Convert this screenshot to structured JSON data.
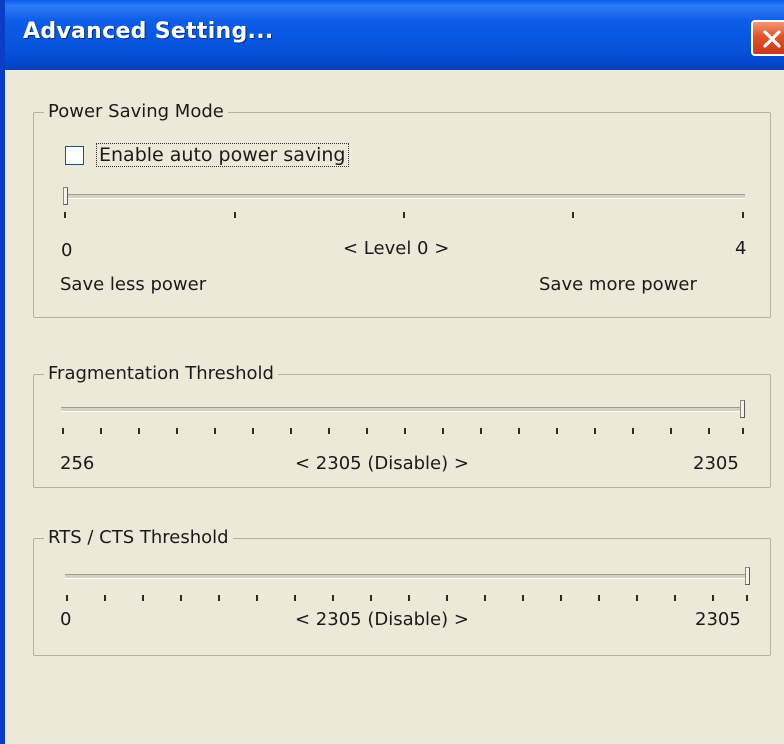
{
  "window": {
    "title": "Advanced Setting..."
  },
  "power_saving": {
    "legend": "Power Saving Mode",
    "checkbox_label": "Enable auto power saving",
    "checkbox_checked": false,
    "slider_min": "0",
    "slider_max": "4",
    "slider_value": 0,
    "current_label": "< Level 0 >",
    "left_caption": "Save less power",
    "right_caption": "Save more power"
  },
  "fragmentation": {
    "legend": "Fragmentation Threshold",
    "slider_min": "256",
    "slider_max": "2305",
    "slider_value": 2305,
    "current_label": "< 2305 (Disable) >"
  },
  "rts_cts": {
    "legend": "RTS / CTS Threshold",
    "slider_min": "0",
    "slider_max": "2305",
    "slider_value": 2305,
    "current_label": "< 2305 (Disable) >"
  }
}
